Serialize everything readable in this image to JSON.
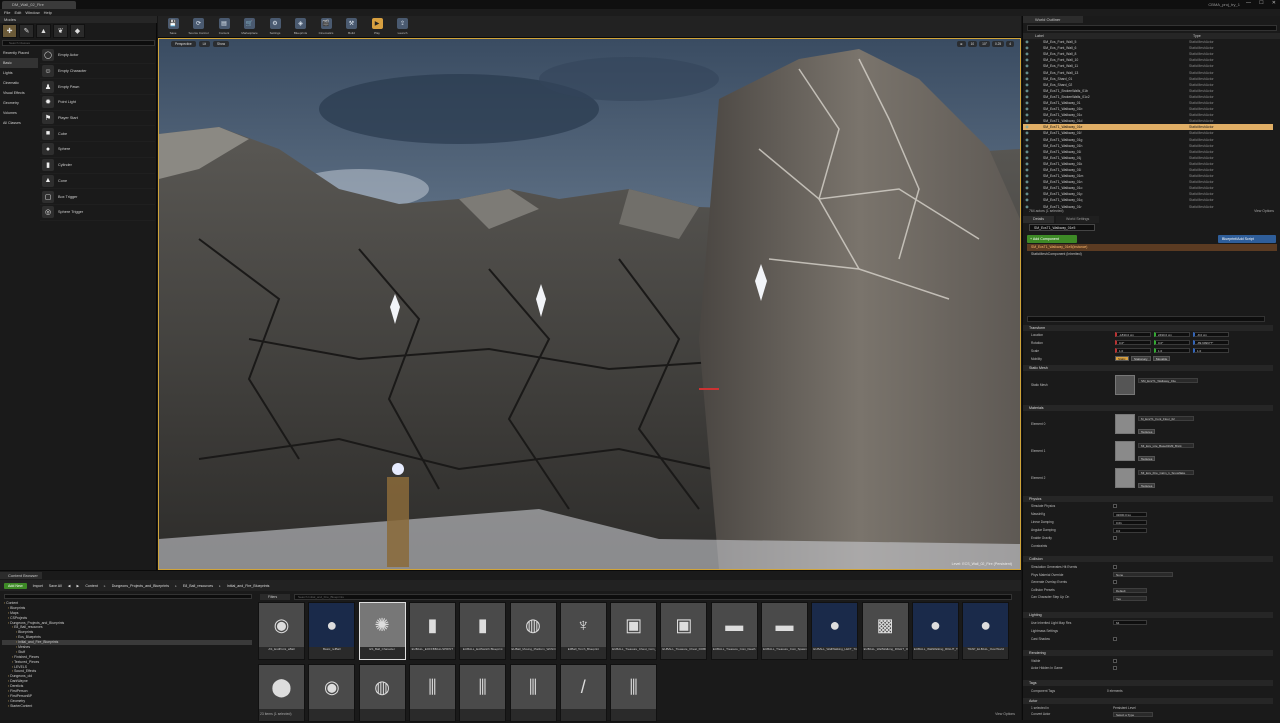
{
  "window": {
    "tab_label": "DM_Wall_02_Fire",
    "project_name": "CBMA_proj_try_1",
    "controls": [
      "—",
      "☐",
      "✕"
    ]
  },
  "menu": [
    "File",
    "Edit",
    "Window",
    "Help"
  ],
  "modes": {
    "title": "Modes",
    "search_placeholder": "Search Classes",
    "categories": [
      "Recently Placed",
      "Basic",
      "Lights",
      "Cinematic",
      "Visual Effects",
      "Geometry",
      "Volumes",
      "All Classes"
    ],
    "active_category": "Basic",
    "items": [
      {
        "label": "Empty Actor",
        "icon": "actor-icon"
      },
      {
        "label": "Empty Character",
        "icon": "character-icon"
      },
      {
        "label": "Empty Pawn",
        "icon": "pawn-icon"
      },
      {
        "label": "Point Light",
        "icon": "point-light-icon"
      },
      {
        "label": "Player Start",
        "icon": "player-start-icon"
      },
      {
        "label": "Cube",
        "icon": "cube-icon"
      },
      {
        "label": "Sphere",
        "icon": "sphere-icon"
      },
      {
        "label": "Cylinder",
        "icon": "cylinder-icon"
      },
      {
        "label": "Cone",
        "icon": "cone-icon"
      },
      {
        "label": "Box Trigger",
        "icon": "box-trigger-icon"
      },
      {
        "label": "Sphere Trigger",
        "icon": "sphere-trigger-icon"
      }
    ]
  },
  "toolbar": {
    "buttons": [
      {
        "label": "Save",
        "icon": "save-icon"
      },
      {
        "label": "Source Control",
        "icon": "source-control-icon"
      },
      {
        "label": "Content",
        "icon": "content-icon"
      },
      {
        "label": "Marketplace",
        "icon": "marketplace-icon"
      },
      {
        "label": "Settings",
        "icon": "settings-icon"
      },
      {
        "label": "Blueprints",
        "icon": "blueprints-icon"
      },
      {
        "label": "Cinematics",
        "icon": "cinematics-icon"
      },
      {
        "label": "Build",
        "icon": "build-icon"
      },
      {
        "label": "Play",
        "icon": "play-icon"
      },
      {
        "label": "Launch",
        "icon": "launch-icon"
      }
    ]
  },
  "viewport": {
    "perspective": "Perspective",
    "lit": "Lit",
    "show": "Show",
    "level_info": "Level: ECS_Wall_02_Fire (Persistent)",
    "right_controls": [
      "⊕",
      "10",
      "10°",
      "0.25",
      "4"
    ]
  },
  "outliner": {
    "tab": "World Outliner",
    "col_label": "Label",
    "col_type": "Type",
    "rows": [
      {
        "label": "SM_Ecs_Font_Wall_5",
        "type": "StaticMeshActor"
      },
      {
        "label": "SM_Ecs_Font_Wall_6",
        "type": "StaticMeshActor"
      },
      {
        "label": "SM_Ecs_Font_Wall_8",
        "type": "StaticMeshActor"
      },
      {
        "label": "SM_Ecs_Font_Wall_10",
        "type": "StaticMeshActor"
      },
      {
        "label": "SM_Ecs_Font_Wall_11",
        "type": "StaticMeshActor"
      },
      {
        "label": "SM_Ecs_Font_Wall_13",
        "type": "StaticMeshActor"
      },
      {
        "label": "SM_Ecs_Shard_01",
        "type": "StaticMeshActor"
      },
      {
        "label": "SM_Ecs_Shard_02",
        "type": "StaticMeshActor"
      },
      {
        "label": "SM_EcsT1_BrokenWalls_01b",
        "type": "StaticMeshActor"
      },
      {
        "label": "SM_EcsT1_BrokenWalls_01c2",
        "type": "StaticMeshActor"
      },
      {
        "label": "SM_EcsT1_Walkway_01",
        "type": "StaticMeshActor"
      },
      {
        "label": "SM_EcsT1_Walkway_01b",
        "type": "StaticMeshActor"
      },
      {
        "label": "SM_EcsT1_Walkway_01c",
        "type": "StaticMeshActor"
      },
      {
        "label": "SM_EcsT1_Walkway_01d",
        "type": "StaticMeshActor"
      },
      {
        "label": "SM_EcsT1_Walkway_01e",
        "type": "StaticMeshActor"
      },
      {
        "label": "SM_EcsT1_Walkway_01f",
        "type": "StaticMeshActor"
      },
      {
        "label": "SM_EcsT1_Walkway_01g",
        "type": "StaticMeshActor"
      },
      {
        "label": "SM_EcsT1_Walkway_01h",
        "type": "StaticMeshActor"
      },
      {
        "label": "SM_EcsT1_Walkway_01i",
        "type": "StaticMeshActor"
      },
      {
        "label": "SM_EcsT1_Walkway_01j",
        "type": "StaticMeshActor"
      },
      {
        "label": "SM_EcsT1_Walkway_01k",
        "type": "StaticMeshActor"
      },
      {
        "label": "SM_EcsT1_Walkway_01l",
        "type": "StaticMeshActor"
      },
      {
        "label": "SM_EcsT1_Walkway_01m",
        "type": "StaticMeshActor"
      },
      {
        "label": "SM_EcsT1_Walkway_01n",
        "type": "StaticMeshActor"
      },
      {
        "label": "SM_EcsT1_Walkway_01o",
        "type": "StaticMeshActor"
      },
      {
        "label": "SM_EcsT1_Walkway_01p",
        "type": "StaticMeshActor"
      },
      {
        "label": "SM_EcsT1_Walkway_01q",
        "type": "StaticMeshActor"
      },
      {
        "label": "SM_EcsT1_Walkway_01r",
        "type": "StaticMeshActor"
      }
    ],
    "selected_index": 14,
    "footer": "764 actors (1 selected)",
    "view_options": "View Options"
  },
  "details": {
    "tabs": [
      "Details",
      "World Settings"
    ],
    "actor_name": "SM_EcsT1_Walkway_01e5",
    "add_component": "+ Add Component",
    "blueprint_script": "Blueprint/Add Script",
    "components": [
      "SM_EcsT1_Walkway_01e5(Instance)",
      "StaticMeshComponent (Inherited)"
    ],
    "transform": {
      "title": "Transform",
      "location_label": "Location",
      "rotation_label": "Rotation",
      "scale_label": "Scale",
      "mobility_label": "Mobility",
      "location": [
        "-1830.0 cm",
        "2490.0 cm",
        "-8.0 cm"
      ],
      "rotation": [
        "0.0°",
        "0.0°",
        "-89.999977°"
      ],
      "scale": [
        "1.0",
        "1.0",
        "1.0"
      ],
      "mobility": [
        "Static",
        "Stationary",
        "Movable"
      ]
    },
    "static_mesh": {
      "title": "Static Mesh",
      "label": "Static Mesh",
      "value": "SM_EcsT1_Walkway_01e"
    },
    "materials": {
      "title": "Materials",
      "elements": [
        {
          "label": "Element 0",
          "value": "M_EcsT1_Font_Floor_02",
          "textures": "Textures"
        },
        {
          "label": "Element 1",
          "value": "MI_Ecs_Lite_Base01Mtl_Brick",
          "textures": "Textures"
        },
        {
          "label": "Element 2",
          "value": "MI_Ecs_Fire_Calm_1_Snowflake",
          "textures": "Textures"
        }
      ]
    },
    "physics": {
      "title": "Physics",
      "rows": [
        "Simulate Physics",
        "MassInKg",
        "Linear Damping",
        "Angular Damping",
        "Enable Gravity",
        "Constraints"
      ],
      "mass": "32000.0 kg",
      "linear_damping": "0.01",
      "angular_damping": "0.0"
    },
    "collision": {
      "title": "Collision",
      "rows": [
        "Simulation Generates Hit Events",
        "Phys Material Override",
        "Generate Overlap Events",
        "Collision Presets",
        "Can Character Step Up On"
      ],
      "phys_override": "None",
      "presets": "Default",
      "step_up": "Yes"
    },
    "lighting": {
      "title": "Lighting",
      "rows": [
        "Use Inherited Light Map Res",
        "Lightmass Settings",
        "Cast Shadow"
      ],
      "lightmap_res": "64"
    },
    "rendering": {
      "title": "Rendering",
      "rows": [
        "Visible",
        "Actor Hidden In Game"
      ]
    },
    "tags": {
      "title": "Tags",
      "rows": [
        "Component Tags"
      ],
      "component_tags": "0 elements"
    },
    "actor": {
      "title": "Actor",
      "rows": [
        "1 selected in",
        "Convert Actor"
      ],
      "level": "Persistent Level",
      "convert": "Select a Type"
    }
  },
  "content_browser": {
    "tab": "Content Browser",
    "add_new": "Add New",
    "import": "Import",
    "save_all": "Save All",
    "breadcrumb": [
      "Content",
      "Dungeons_Projects_and_Blueprints",
      "E8_Ball_resources",
      "Initial_and_Fire_Blueprints"
    ],
    "filters": "Filters",
    "search_placeholder": "Search Initial_and_Fire_Blueprints",
    "tree": [
      {
        "label": "Content",
        "depth": 0
      },
      {
        "label": "Blueprints",
        "depth": 1
      },
      {
        "label": "Maps",
        "depth": 1
      },
      {
        "label": "CSProjects",
        "depth": 1
      },
      {
        "label": "Dungeons_Projects_and_Blueprints",
        "depth": 1
      },
      {
        "label": "E8_Ball_resources",
        "depth": 2
      },
      {
        "label": "Blueprints",
        "depth": 3
      },
      {
        "label": "Ecs_Blueprints",
        "depth": 3
      },
      {
        "label": "Initial_and_Fire_Blueprints",
        "depth": 3
      },
      {
        "label": "Meshes",
        "depth": 3
      },
      {
        "label": "Stuff",
        "depth": 3
      },
      {
        "label": "Finished_Pieces",
        "depth": 2
      },
      {
        "label": "Textured_Pieces",
        "depth": 2
      },
      {
        "label": "LEVELS",
        "depth": 2
      },
      {
        "label": "Sound_Effects",
        "depth": 2
      },
      {
        "label": "Dungeons_old",
        "depth": 1
      },
      {
        "label": "DarkWayne",
        "depth": 1
      },
      {
        "label": "Derelicts",
        "depth": 1
      },
      {
        "label": "FirstPerson",
        "depth": 1
      },
      {
        "label": "FirstPersonBP",
        "depth": 1
      },
      {
        "label": "Geometry",
        "depth": 1
      },
      {
        "label": "StarterContent",
        "depth": 1
      }
    ],
    "selected_tree_index": 8,
    "assets": [
      {
        "name": "AS_EndPoint_aBall",
        "kind": "mesh"
      },
      {
        "name": "Basic_refBall",
        "kind": "bp"
      },
      {
        "name": "ES_Ball_Character",
        "kind": "sel"
      },
      {
        "name": "EUBALL_EOFFBBALLSPRINT",
        "kind": "mesh"
      },
      {
        "name": "EUBALL_EvilSwitch Blueprint",
        "kind": "mesh"
      },
      {
        "name": "EUBall_Moving_Platform_WithOrb",
        "kind": "mesh"
      },
      {
        "name": "E3Ball_Torch_Blueprint",
        "kind": "mesh"
      },
      {
        "name": "EUBALL_Treasure_Chest_Coin_Variable",
        "kind": "mesh"
      },
      {
        "name": "EUBALL_Treasure_Chest_DOBUS",
        "kind": "mesh"
      },
      {
        "name": "EUBALL_Treasure_Coin_Death",
        "kind": "mesh"
      },
      {
        "name": "EUBALL_Treasure_Coin_Spawn",
        "kind": "mesh"
      },
      {
        "name": "EUBALL_WallWalking_LEFT_Trig_Box",
        "kind": "bp"
      },
      {
        "name": "EUBALL_WallWalking_RIGHT_OnGlitch",
        "kind": "mesh"
      },
      {
        "name": "EUBALL_WallWalking_RIGHT_Trig_Box",
        "kind": "bp"
      },
      {
        "name": "TRAP_ELBALL_OverWorld",
        "kind": "bp"
      },
      {
        "name": "",
        "kind": "mesh"
      },
      {
        "name": "",
        "kind": "mesh"
      },
      {
        "name": "",
        "kind": "mesh"
      },
      {
        "name": "",
        "kind": "mesh"
      },
      {
        "name": "",
        "kind": "mesh"
      },
      {
        "name": "",
        "kind": "mesh"
      },
      {
        "name": "",
        "kind": "mesh"
      },
      {
        "name": "",
        "kind": "mesh"
      }
    ],
    "item_count": "23 items (1 selected)",
    "view_options": "View Options"
  }
}
